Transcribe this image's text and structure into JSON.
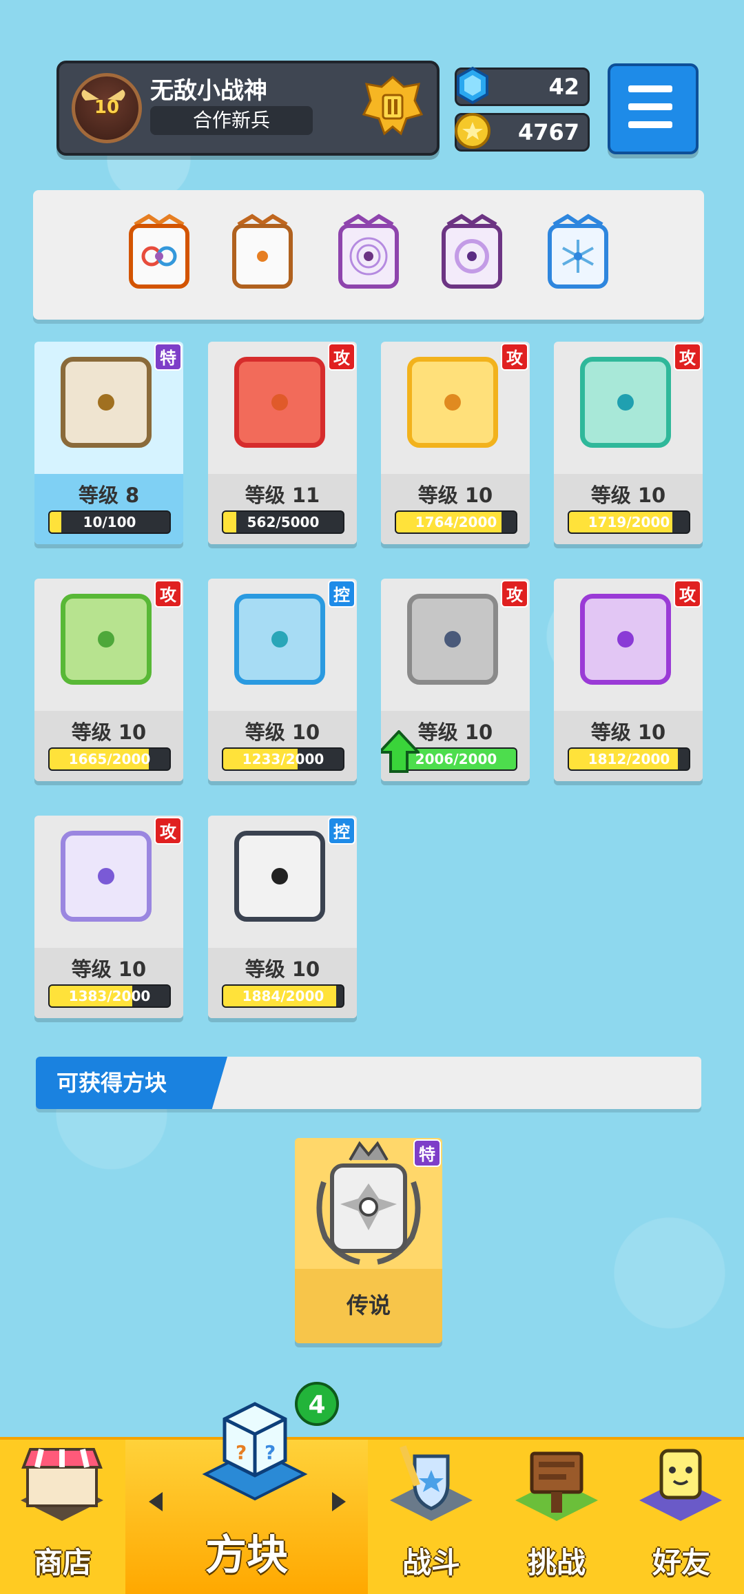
{
  "header": {
    "player_name": "无敌小战神",
    "player_title": "合作新兵",
    "player_level": "10",
    "gems": "42",
    "coins": "4767",
    "rank_icon": "gold-rank-badge-icon",
    "menu_icon": "hamburger-menu-icon"
  },
  "deck": {
    "slots": [
      {
        "icon": "rainbow-infinity-dice-icon",
        "color": "#e67e22"
      },
      {
        "icon": "orange-pip-dice-icon",
        "color": "#e67e22"
      },
      {
        "icon": "purple-magic-circle-dice-icon",
        "color": "#8e44ad"
      },
      {
        "icon": "purple-arrow-dice-icon",
        "color": "#8e44ad"
      },
      {
        "icon": "ice-snowflake-dice-icon",
        "color": "#3498db"
      }
    ]
  },
  "dice": [
    {
      "level_label": "等级 8",
      "progress": "10/100",
      "fill": 0.1,
      "tag": "特",
      "tag_color": "#7d3ec8",
      "face_border": "#8a6a3a",
      "face_bg": "#efe4d0",
      "pip": "#a07020",
      "selected": true
    },
    {
      "level_label": "等级 11",
      "progress": "562/5000",
      "fill": 0.11,
      "tag": "攻",
      "tag_color": "#e02020",
      "face_border": "#d62c2c",
      "face_bg": "#f26b5a",
      "pip": "#e05a2a"
    },
    {
      "level_label": "等级 10",
      "progress": "1764/2000",
      "fill": 0.88,
      "tag": "攻",
      "tag_color": "#e02020",
      "face_border": "#f2b21c",
      "face_bg": "#ffe07a",
      "pip": "#e08a20"
    },
    {
      "level_label": "等级 10",
      "progress": "1719/2000",
      "fill": 0.86,
      "tag": "攻",
      "tag_color": "#e02020",
      "face_border": "#2fb89a",
      "face_bg": "#a8e8d8",
      "pip": "#20a0b0"
    },
    {
      "level_label": "等级 10",
      "progress": "1665/2000",
      "fill": 0.83,
      "tag": "攻",
      "tag_color": "#e02020",
      "face_border": "#58b836",
      "face_bg": "#b7e38f",
      "pip": "#4ea83a"
    },
    {
      "level_label": "等级 10",
      "progress": "1233/2000",
      "fill": 0.62,
      "tag": "控",
      "tag_color": "#1e8be8",
      "face_border": "#2a9ae0",
      "face_bg": "#a7dcf4",
      "pip": "#2aa6b8"
    },
    {
      "level_label": "等级 10",
      "progress": "2006/2000",
      "fill": 1.0,
      "tag": "攻",
      "tag_color": "#e02020",
      "face_border": "#8a8a8a",
      "face_bg": "#c6c6c6",
      "pip": "#4a5a7a",
      "upgradable": true
    },
    {
      "level_label": "等级 10",
      "progress": "1812/2000",
      "fill": 0.91,
      "tag": "攻",
      "tag_color": "#e02020",
      "face_border": "#9a3ad6",
      "face_bg": "#e2c6f4",
      "pip": "#8a3ad6"
    },
    {
      "level_label": "等级 10",
      "progress": "1383/2000",
      "fill": 0.69,
      "tag": "攻",
      "tag_color": "#e02020",
      "face_border": "#9a86e0",
      "face_bg": "#ece6fb",
      "pip": "#7a5ad6"
    },
    {
      "level_label": "等级 10",
      "progress": "1884/2000",
      "fill": 0.94,
      "tag": "控",
      "tag_color": "#1e8be8",
      "face_border": "#3a4250",
      "face_bg": "#f2f2f2",
      "pip": "#222222"
    }
  ],
  "obtainable": {
    "title": "可获得方块",
    "card_label": "传说",
    "card_tag": "特",
    "card_icon": "legendary-dragon-dice-icon"
  },
  "nav": {
    "shop": "商店",
    "dice": "方块",
    "battle": "战斗",
    "challenge": "挑战",
    "friends": "好友",
    "dice_badge": "4"
  }
}
